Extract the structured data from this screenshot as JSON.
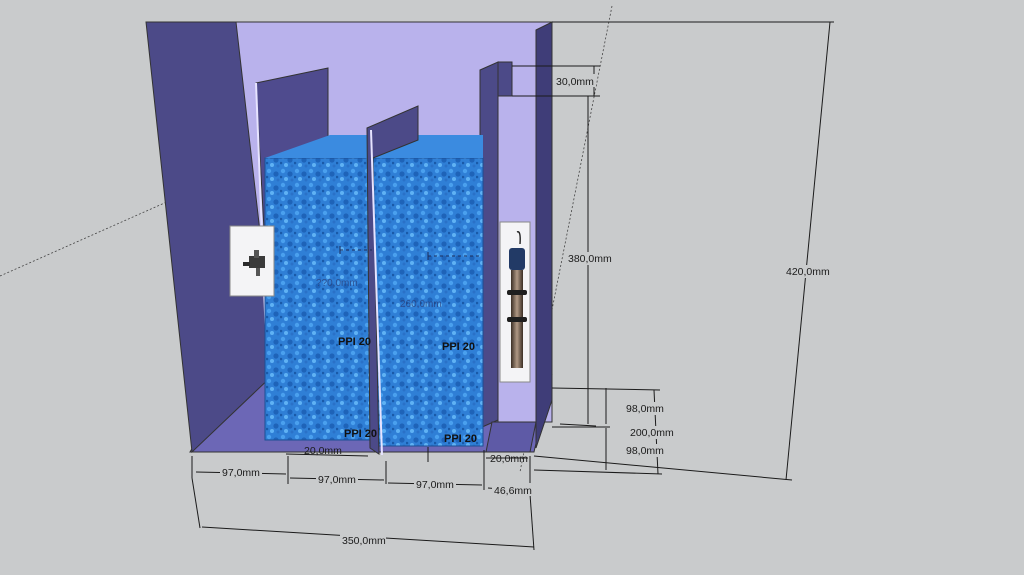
{
  "labels": {
    "foam_block_left": "PPI 20",
    "foam_block_right": "PPI 20",
    "foam_base_left": "PPI 20",
    "foam_base_right": "PPI 20",
    "faint_left": "??0,0mm",
    "faint_right": "260,0mm"
  },
  "dimensions": {
    "bottom_seg1": "97,0mm",
    "bottom_seg2": "97,0mm",
    "bottom_seg3": "97,0mm",
    "bottom_seg4": "46,6mm",
    "overall_width": "350,0mm",
    "gap_left": "20,0mm",
    "gap_right": "20,0mm",
    "top_gap": "30,0mm",
    "chamber_height": "380,0mm",
    "total_height": "420,0mm",
    "lower_a": "98,0mm",
    "lower_b": "98,0mm",
    "lower_total": "200,0mm"
  },
  "colors": {
    "background": "#c9cbcc",
    "wall_dark": "#4c4a88",
    "wall_light": "#b9b2ec",
    "floor": "#6c67b6",
    "foam": "#2f7fd6"
  },
  "icons": {
    "pump": "pump-icon",
    "heater": "heater-icon"
  }
}
